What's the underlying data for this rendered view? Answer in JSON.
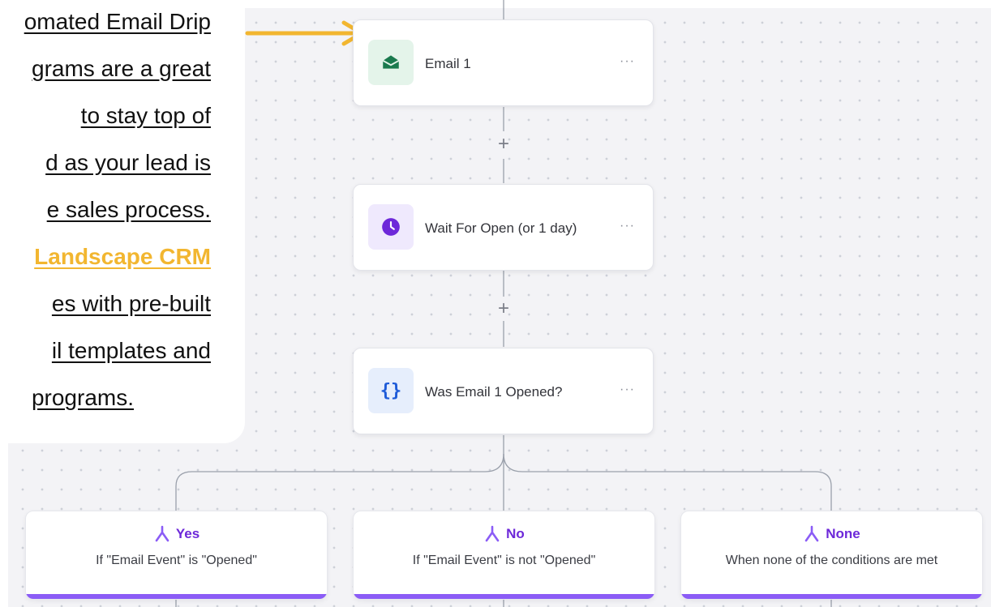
{
  "callout": {
    "lines": [
      "omated Email Drip",
      "grams are a great",
      "to stay top of",
      "d as your lead is",
      "e sales process.",
      "Landscape CRM",
      "es with pre-built",
      "il templates and",
      "programs."
    ],
    "highlight_line_index": 5
  },
  "nodes": [
    {
      "label": "Email 1",
      "icon": "envelope-icon",
      "menu": "···"
    },
    {
      "label": "Wait For Open (or 1 day)",
      "icon": "clock-icon",
      "menu": "···"
    },
    {
      "label": "Was Email 1 Opened?",
      "icon": "braces-icon",
      "menu": "···"
    }
  ],
  "plus_label": "+",
  "branches": [
    {
      "title": "Yes",
      "description": "If \"Email Event\" is \"Opened\""
    },
    {
      "title": "No",
      "description": "If \"Email Event\" is not \"Opened\""
    },
    {
      "title": "None",
      "description": "When none of the conditions are met"
    }
  ],
  "colors": {
    "accent_purple": "#8b5cf6",
    "highlight_yellow": "#f2b630",
    "email_icon_green": "#1a7a4e",
    "clock_icon_purple": "#6d28d9",
    "braces_icon_blue": "#1e5bd8"
  }
}
